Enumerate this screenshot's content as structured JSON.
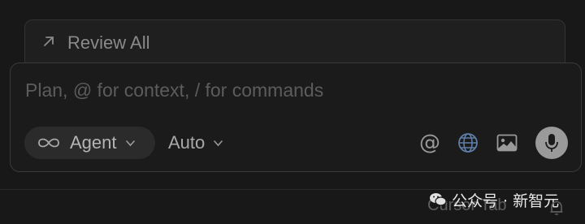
{
  "review": {
    "label": "Review All",
    "icon": "arrow-up-right-icon"
  },
  "composer": {
    "placeholder": "Plan, @ for context, / for commands",
    "mode": {
      "label": "Agent",
      "icon": "infinity-icon"
    },
    "model": {
      "label": "Auto"
    },
    "tools": {
      "mention_symbol": "@",
      "icons": [
        "at-icon",
        "globe-icon",
        "image-icon",
        "microphone-icon"
      ]
    }
  },
  "footer": {
    "tab_label": "Cursor Tab",
    "watermark": "公众号 · 新智元",
    "watermark_icon": "wechat-icon",
    "bell_icon": "bell-icon"
  },
  "colors": {
    "background": "#181818",
    "composer_bg": "#1b1b1b",
    "border": "#3a3a3a",
    "pill_bg": "#2b2b2b",
    "globe_accent": "#5f7ea8",
    "mic_bg": "#9a9a9a"
  }
}
